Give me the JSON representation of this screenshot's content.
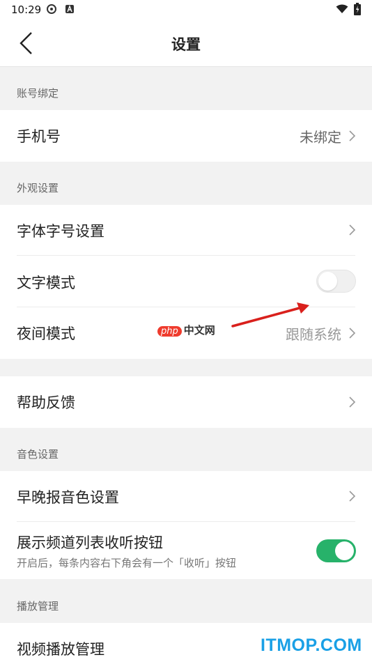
{
  "status_bar": {
    "time": "10:29"
  },
  "header": {
    "title": "设置"
  },
  "sections": {
    "account": {
      "title": "账号绑定",
      "phone": {
        "label": "手机号",
        "value": "未绑定"
      }
    },
    "appearance": {
      "title": "外观设置",
      "font": {
        "label": "字体字号设置"
      },
      "text_mode": {
        "label": "文字模式",
        "enabled": false
      },
      "night_mode": {
        "label": "夜间模式",
        "value": "跟随系统"
      }
    },
    "help": {
      "label": "帮助反馈"
    },
    "voice": {
      "title": "音色设置",
      "briefing_voice": {
        "label": "早晚报音色设置"
      },
      "listen_button": {
        "label": "展示频道列表收听按钮",
        "description": "开启后，每条内容右下角会有一个「收听」按钮",
        "enabled": true
      }
    },
    "playback": {
      "title": "播放管理",
      "video": {
        "label": "视频播放管理"
      }
    }
  },
  "watermarks": {
    "php_badge": "php",
    "php_text": "中文网",
    "itmop": "ITMOP.COM"
  },
  "colors": {
    "accent_green": "#27b26a",
    "annotation_red": "#d9201c",
    "watermark_blue": "#1aa0e6"
  }
}
